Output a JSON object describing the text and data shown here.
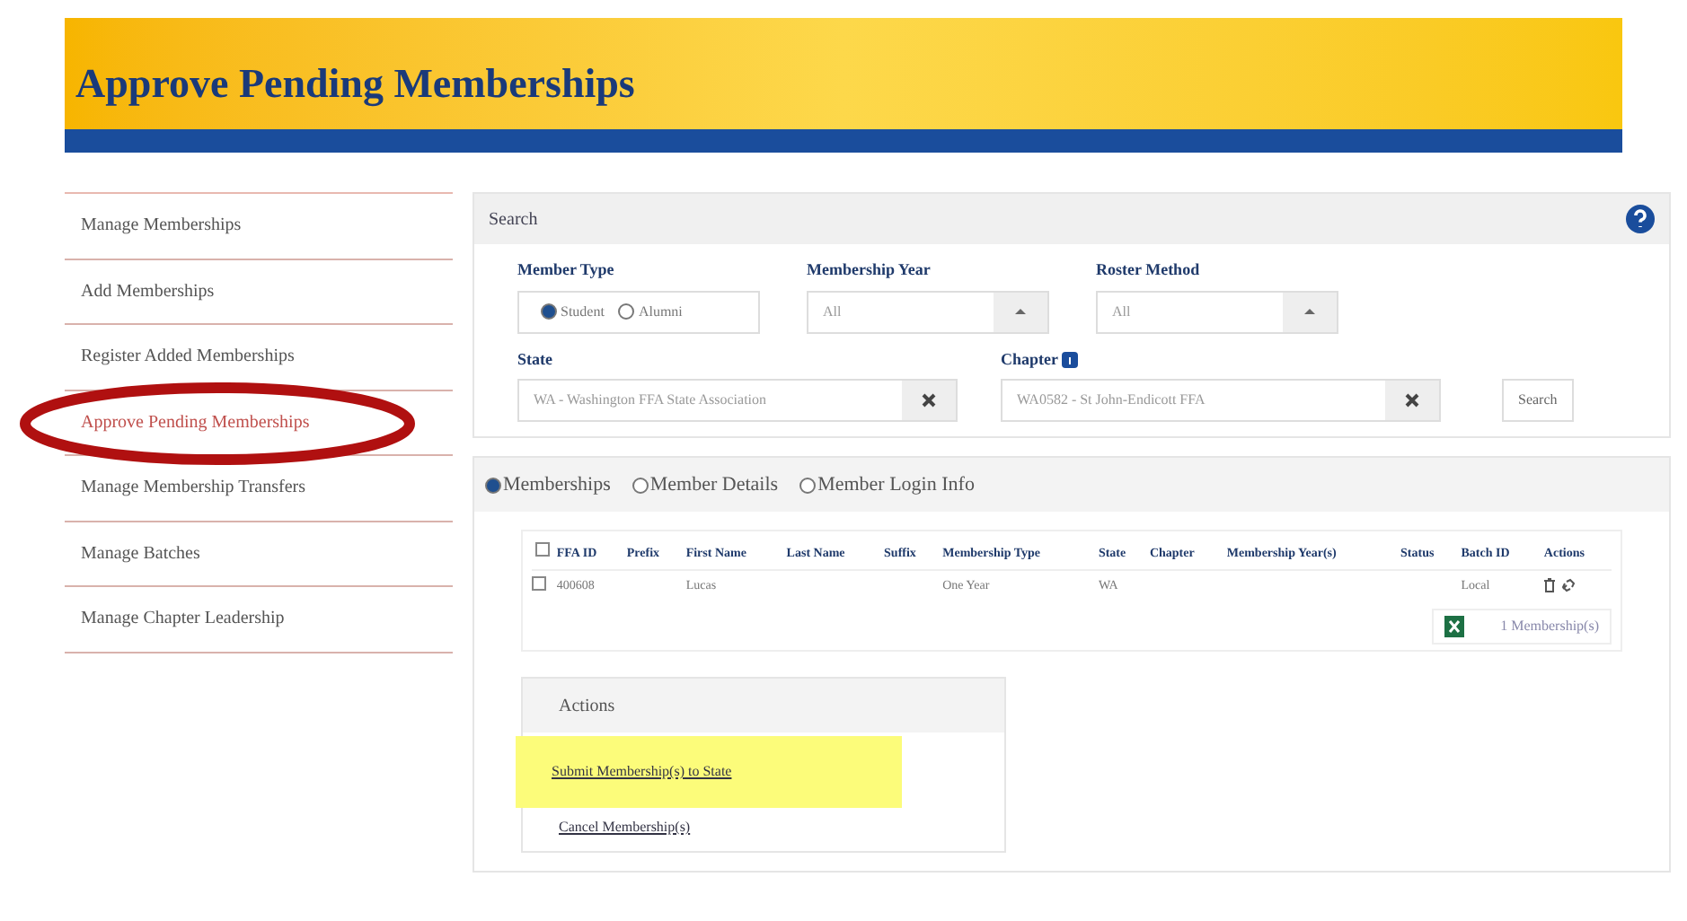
{
  "header": {
    "title": "Approve Pending Memberships"
  },
  "sidebar": {
    "items": [
      {
        "label": "Manage Memberships",
        "selected": false,
        "circled": false
      },
      {
        "label": "Add Memberships",
        "selected": false,
        "circled": false
      },
      {
        "label": "Register Added Memberships",
        "selected": false,
        "circled": false
      },
      {
        "label": "Approve Pending Memberships",
        "selected": true,
        "circled": true
      },
      {
        "label": "Manage Membership Transfers",
        "selected": false,
        "circled": false
      },
      {
        "label": "Manage Batches",
        "selected": false,
        "circled": false
      },
      {
        "label": "Manage Chapter Leadership",
        "selected": false,
        "circled": false
      }
    ]
  },
  "search": {
    "title": "Search",
    "member_type": {
      "label": "Member Type",
      "options": [
        {
          "label": "Student",
          "selected": true
        },
        {
          "label": "Alumni",
          "selected": false
        }
      ]
    },
    "membership_year": {
      "label": "Membership Year",
      "value": "All"
    },
    "roster_method": {
      "label": "Roster Method",
      "value": "All"
    },
    "state": {
      "label": "State",
      "value": "WA - Washington FFA State Association"
    },
    "chapter": {
      "label": "Chapter",
      "value": "WA0582 - St John-Endicott FFA"
    },
    "button": "Search"
  },
  "tabs": [
    {
      "label": "Memberships",
      "selected": true
    },
    {
      "label": "Member Details",
      "selected": false
    },
    {
      "label": "Member Login Info",
      "selected": false
    }
  ],
  "table": {
    "select_all": false,
    "columns": [
      "FFA ID",
      "Prefix",
      "First Name",
      "Last Name",
      "Suffix",
      "Membership Type",
      "State",
      "Chapter",
      "Membership Year(s)",
      "Status",
      "Batch ID",
      "Actions"
    ],
    "rows": [
      {
        "checked": false,
        "cells": [
          "400608",
          "",
          "Lucas",
          "",
          "",
          "One Year",
          "WA",
          "",
          "",
          "",
          "Local",
          ""
        ]
      }
    ],
    "count": "1 Membership(s)"
  },
  "actions": {
    "title": "Actions",
    "items": [
      {
        "label": "Submit Membership(s) to State",
        "highlighted": true
      },
      {
        "label": "Cancel Membership(s)",
        "highlighted": false
      }
    ]
  }
}
